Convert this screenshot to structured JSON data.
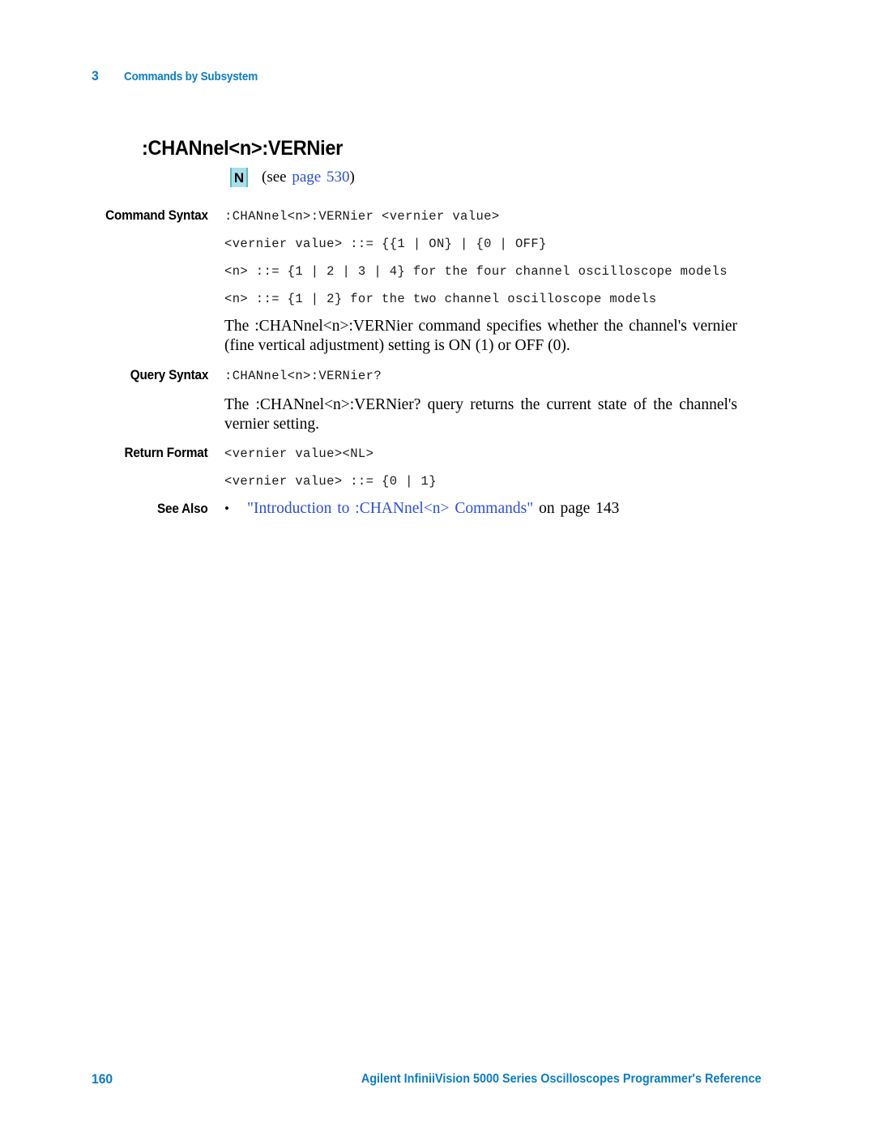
{
  "header": {
    "chapter_number": "3",
    "chapter_title": "Commands by Subsystem"
  },
  "command": {
    "title": ":CHANnel<n>:VERNier",
    "badge": "N",
    "see_prefix": "(see",
    "see_link_label": "page",
    "see_link_page": "530",
    "see_suffix": ")"
  },
  "sections": {
    "command_syntax": {
      "label": "Command Syntax",
      "lines": [
        ":CHANnel<n>:VERNier <vernier value>",
        "<vernier value> ::= {{1 | ON} | {0 | OFF}",
        "<n> ::= {1 | 2 | 3 | 4} for the four channel oscilloscope models",
        "<n> ::= {1 | 2} for the two channel oscilloscope models"
      ],
      "description": "The :CHANnel<n>:VERNier command specifies whether the channel's vernier (fine vertical adjustment) setting is ON (1) or OFF (0)."
    },
    "query_syntax": {
      "label": "Query Syntax",
      "lines": [
        ":CHANnel<n>:VERNier?"
      ],
      "description": "The :CHANnel<n>:VERNier? query returns the current state of the channel's vernier setting."
    },
    "return_format": {
      "label": "Return Format",
      "lines": [
        "<vernier value><NL>",
        "<vernier value> ::= {0 | 1}"
      ]
    },
    "see_also": {
      "label": "See Also",
      "bullet": "•",
      "link_text": "\"Introduction to :CHANnel<n> Commands\"",
      "trailing_text": "on page 143"
    }
  },
  "footer": {
    "page_number": "160",
    "document_title": "Agilent InfiniiVision 5000 Series Oscilloscopes Programmer's Reference"
  },
  "colors": {
    "accent_blue": "#0b7cc4",
    "link_blue": "#2b4fd8",
    "badge_fill": "#a9dfe8",
    "badge_edge": "#5bb8c8"
  }
}
